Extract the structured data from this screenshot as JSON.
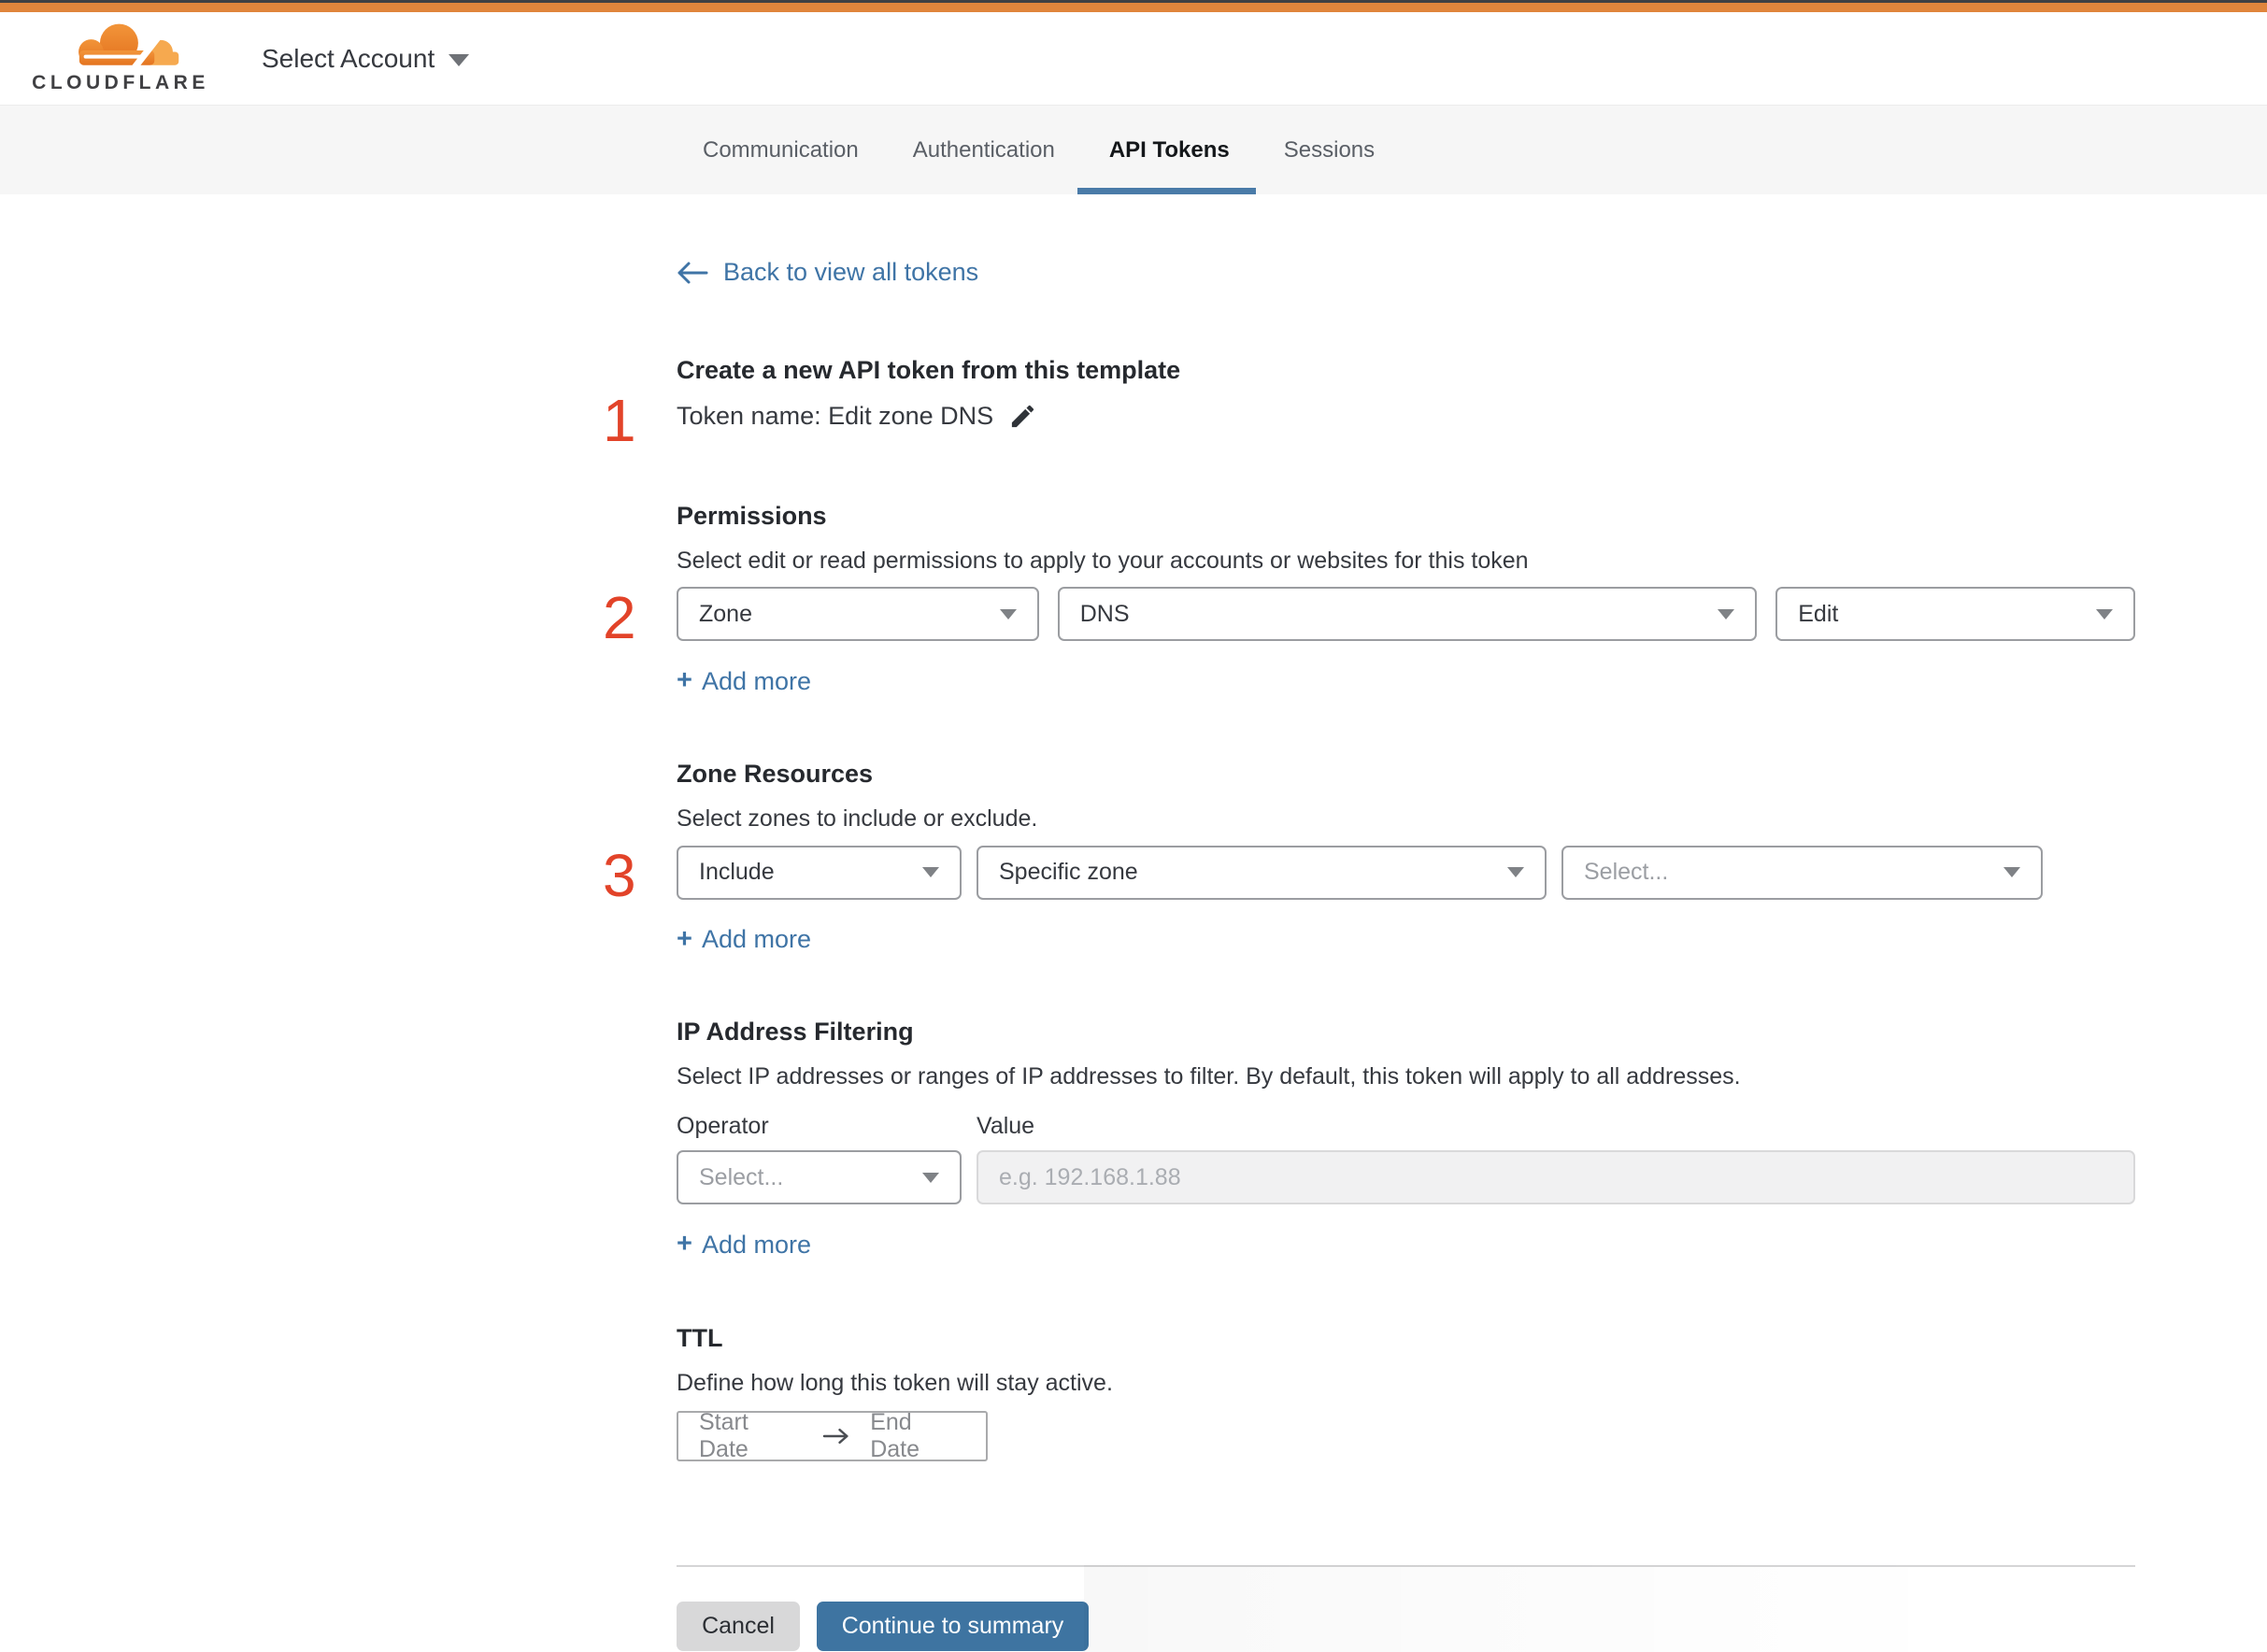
{
  "header": {
    "logo_text": "CLOUDFLARE",
    "account_selector_label": "Select Account"
  },
  "tabs": [
    {
      "label": "Communication",
      "active": false
    },
    {
      "label": "Authentication",
      "active": false
    },
    {
      "label": "API Tokens",
      "active": true
    },
    {
      "label": "Sessions",
      "active": false
    }
  ],
  "back_link_label": "Back to view all tokens",
  "template_section": {
    "step": "1",
    "heading": "Create a new API token from this template",
    "token_name_label": "Token name: Edit zone DNS"
  },
  "permissions": {
    "step": "2",
    "heading": "Permissions",
    "description": "Select edit or read permissions to apply to your accounts or websites for this token",
    "scope_value": "Zone",
    "resource_value": "DNS",
    "access_value": "Edit",
    "plus": "+",
    "add_more_label": "Add more"
  },
  "zone_resources": {
    "step": "3",
    "heading": "Zone Resources",
    "description": "Select zones to include or exclude.",
    "mode_value": "Include",
    "scope_value": "Specific zone",
    "zone_placeholder": "Select...",
    "plus": "+",
    "add_more_label": "Add more"
  },
  "ip_filtering": {
    "heading": "IP Address Filtering",
    "description": "Select IP addresses or ranges of IP addresses to filter. By default, this token will apply to all addresses.",
    "operator_label": "Operator",
    "value_label": "Value",
    "operator_placeholder": "Select...",
    "value_placeholder": "e.g. 192.168.1.88",
    "plus": "+",
    "add_more_label": "Add more"
  },
  "ttl": {
    "heading": "TTL",
    "description": "Define how long this token will stay active.",
    "start_date_placeholder": "Start Date",
    "end_date_placeholder": "End Date"
  },
  "actions": {
    "cancel_label": "Cancel",
    "continue_label": "Continue to summary"
  },
  "colors": {
    "accent_orange": "#e0853c",
    "brand_dark": "#404043",
    "link_blue": "#3f74a6",
    "primary_button_blue": "#3e74a1",
    "active_tab_underline": "#4a7ba8",
    "step_number_red": "#e24329",
    "text_dark": "#36393f",
    "tabbar_background": "#f6f6f6"
  }
}
